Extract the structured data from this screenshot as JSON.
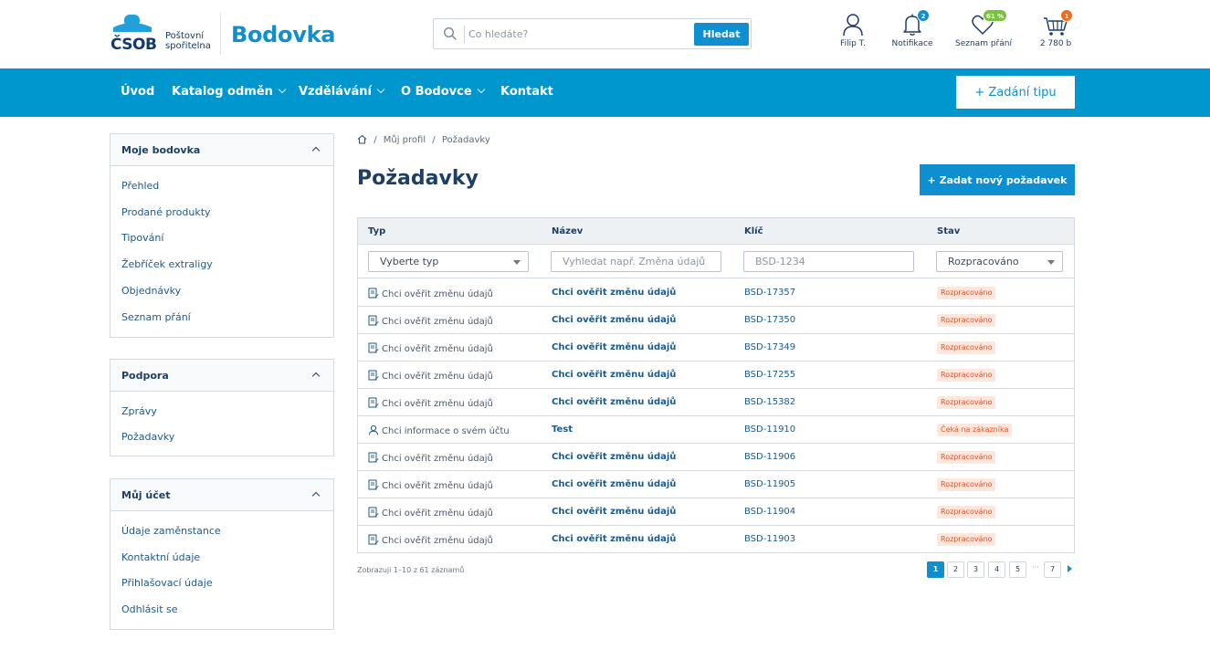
{
  "header": {
    "logo": {
      "word": "ČSOB",
      "sub": "Poštovní spořitelna"
    },
    "brand": "Bodovka",
    "search": {
      "placeholder": "Co hledáte?",
      "button": "Hledat"
    },
    "user": {
      "label": "Filip T."
    },
    "notifications": {
      "label": "Notifikace",
      "badge": "2"
    },
    "wishlist": {
      "label": "Seznam přání",
      "badge": "61 %"
    },
    "cart": {
      "label": "2 780 b",
      "badge": "1"
    },
    "colors": {
      "primary": "#0097cf",
      "badge_blue": "#0f8fcf",
      "badge_green": "#7ac142",
      "badge_orange": "#f26b1d"
    }
  },
  "nav": {
    "items": [
      {
        "label": "Úvod",
        "has_dropdown": false
      },
      {
        "label": "Katalog odměn",
        "has_dropdown": true
      },
      {
        "label": "Vzdělávání",
        "has_dropdown": true
      },
      {
        "label": "O Bodovce",
        "has_dropdown": true
      },
      {
        "label": "Kontakt",
        "has_dropdown": false
      }
    ],
    "tip_button": "+  Zadání tipu"
  },
  "sidebar": {
    "sections": [
      {
        "title": "Moje bodovka",
        "items": [
          "Přehled",
          "Prodané produkty",
          "Tipování",
          "Žebříček extraligy",
          "Objednávky",
          "Seznam přání"
        ]
      },
      {
        "title": "Podpora",
        "items": [
          "Zprávy",
          "Požadavky"
        ]
      },
      {
        "title": "Můj účet",
        "items": [
          "Údaje zaměnstance",
          "Kontaktní údaje",
          "Přihlašovací údaje",
          "Odhlásit se"
        ]
      }
    ]
  },
  "breadcrumb": {
    "items": [
      "Můj profil",
      "Požadavky"
    ],
    "separator": "/"
  },
  "page": {
    "title": "Požadavky",
    "new_button": "+  Zadat nový požadavek"
  },
  "table": {
    "columns": [
      "Typ",
      "Název",
      "Klíč",
      "Stav"
    ],
    "filters": {
      "type_select": "Vyberte typ",
      "name_placeholder": "Vyhledat např. Změna údajů",
      "key_placeholder": "BSD-1234",
      "status_select": "Rozpracováno"
    },
    "rows": [
      {
        "icon": "document-edit-icon",
        "type": "Chci ověřit změnu údajů",
        "name": "Chci ověřit změnu údajů",
        "key": "BSD-17357",
        "status": "Rozpracováno"
      },
      {
        "icon": "document-edit-icon",
        "type": "Chci ověřit změnu údajů",
        "name": "Chci ověřit změnu údajů",
        "key": "BSD-17350",
        "status": "Rozpracováno"
      },
      {
        "icon": "document-edit-icon",
        "type": "Chci ověřit změnu údajů",
        "name": "Chci ověřit změnu údajů",
        "key": "BSD-17349",
        "status": "Rozpracováno"
      },
      {
        "icon": "document-edit-icon",
        "type": "Chci ověřit změnu údajů",
        "name": "Chci ověřit změnu údajů",
        "key": "BSD-17255",
        "status": "Rozpracováno"
      },
      {
        "icon": "document-edit-icon",
        "type": "Chci ověřit změnu údajů",
        "name": "Chci ověřit změnu údajů",
        "key": "BSD-15382",
        "status": "Rozpracováno"
      },
      {
        "icon": "user-icon",
        "type": "Chci informace o svém účtu",
        "name": "Test",
        "key": "BSD-11910",
        "status": "Čeká na zákazníka"
      },
      {
        "icon": "document-edit-icon",
        "type": "Chci ověřit změnu údajů",
        "name": "Chci ověřit změnu údajů",
        "key": "BSD-11906",
        "status": "Rozpracováno"
      },
      {
        "icon": "document-edit-icon",
        "type": "Chci ověřit změnu údajů",
        "name": "Chci ověřit změnu údajů",
        "key": "BSD-11905",
        "status": "Rozpracováno"
      },
      {
        "icon": "document-edit-icon",
        "type": "Chci ověřit změnu údajů",
        "name": "Chci ověřit změnu údajů",
        "key": "BSD-11904",
        "status": "Rozpracováno"
      },
      {
        "icon": "document-edit-icon",
        "type": "Chci ověřit změnu údajů",
        "name": "Chci ověřit změnu údajů",
        "key": "BSD-11903",
        "status": "Rozpracováno"
      }
    ]
  },
  "pagination": {
    "info": "Zobrazuji 1–10 z 61 záznamů",
    "pages": [
      "1",
      "2",
      "3",
      "4",
      "5",
      "7"
    ],
    "active": "1",
    "ellipsis": "···"
  }
}
